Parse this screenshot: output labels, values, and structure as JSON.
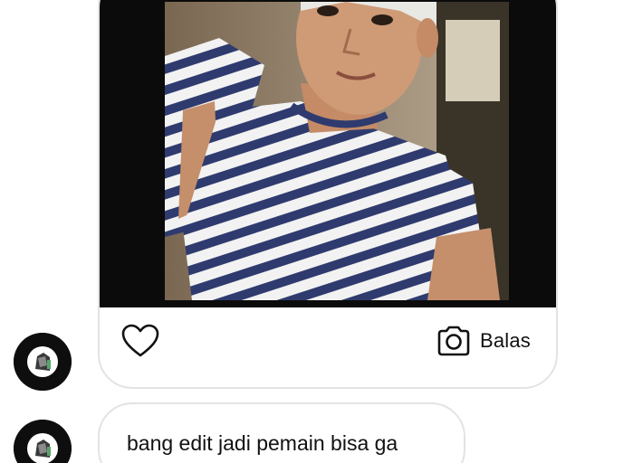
{
  "story_reply": {
    "photo_icon": "story-photo",
    "like_icon": "heart-icon",
    "reply_icon": "camera-icon",
    "reply_label": "Balas"
  },
  "messages": [
    {
      "text": "bang edit jadi pemain bisa ga"
    }
  ],
  "colors": {
    "border": "#e3e3e3",
    "text": "#111111",
    "photo_background": "#0b0b0b",
    "stripe_navy": "#2f3b6e"
  }
}
